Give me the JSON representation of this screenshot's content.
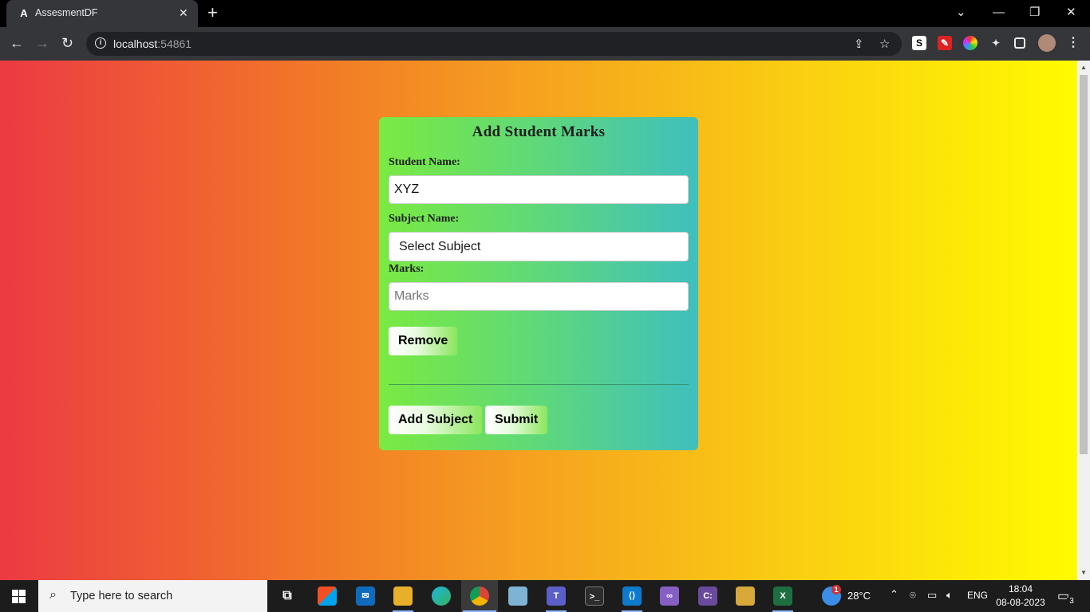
{
  "browser": {
    "tab_title": "AssesmentDF",
    "tab_favicon": "A",
    "address_host": "localhost",
    "address_port": ":54861"
  },
  "form": {
    "title": "Add Student Marks",
    "student_name_label": "Student Name:",
    "student_name_value": "XYZ",
    "subject_name_label": "Subject Name:",
    "subject_select_value": "Select Subject",
    "marks_label": "Marks:",
    "marks_placeholder": "Marks",
    "remove_button": "Remove",
    "add_subject_button": "Add Subject",
    "submit_button": "Submit"
  },
  "colors": {
    "page_gradient": [
      "#ec3a43",
      "#f27a27",
      "#f6a31f",
      "#fad011",
      "#fffb00"
    ],
    "card_gradient": [
      "#7aea41",
      "#5fd87a",
      "#3fbfbe"
    ],
    "button_gradient": [
      "#ffffff",
      "#e9fbe0",
      "#8be65c"
    ]
  },
  "taskbar": {
    "search_placeholder": "Type here to search",
    "weather_temp": "28°C",
    "weather_badge": "1",
    "language": "ENG",
    "time": "18:04",
    "date": "08-08-2023",
    "notification_count": "3",
    "apps": [
      "task-view",
      "microsoft-store",
      "mail",
      "file-explorer",
      "edge",
      "chrome",
      "notes",
      "teams",
      "terminal",
      "vscode",
      "visual-studio",
      "sql-cmd",
      "app-updater",
      "excel"
    ]
  }
}
